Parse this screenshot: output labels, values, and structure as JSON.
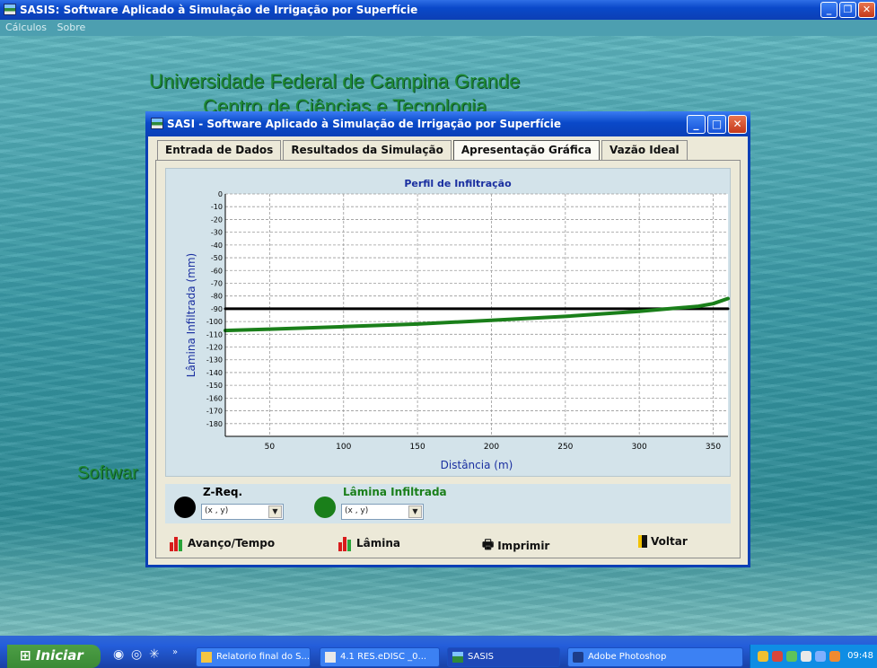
{
  "app": {
    "title": "SASIS: Software Aplicado à Simulação de Irrigação por Superfície",
    "menu": [
      "Cálculos",
      "Sobre"
    ]
  },
  "background": {
    "heading1": "Universidade Federal de Campina Grande",
    "heading2": "Centro de Ciências e Tecnologia",
    "partial_text": "Softwar"
  },
  "dialog": {
    "title": "SASI - Software Aplicado à Simulação de Irrigação por Superfície",
    "tabs": [
      "Entrada de Dados",
      "Resultados da Simulação",
      "Apresentação Gráfica",
      "Vazão Ideal"
    ],
    "active_tab": "Apresentação Gráfica",
    "legend": {
      "zreq_label": "Z-Req.",
      "lamina_label": "Lâmina Infiltrada",
      "combo_value": "(x , y)"
    },
    "buttons": {
      "avanco": "Avanço/Tempo",
      "lamina": "Lâmina",
      "imprimir": "Imprimir",
      "voltar": "Voltar"
    }
  },
  "chart_data": {
    "type": "line",
    "title": "Perfil de Infiltração",
    "xlabel": "Distância (m)",
    "ylabel": "Lâmina Infiltrada (mm)",
    "xlim": [
      20,
      360
    ],
    "ylim": [
      -190,
      0
    ],
    "x_ticks": [
      50,
      100,
      150,
      200,
      250,
      300,
      350
    ],
    "y_ticks": [
      0,
      -10,
      -20,
      -30,
      -40,
      -50,
      -60,
      -70,
      -80,
      -90,
      -100,
      -110,
      -120,
      -130,
      -140,
      -150,
      -160,
      -170,
      -180
    ],
    "grid": true,
    "series": [
      {
        "name": "Z-Req.",
        "color": "#000000",
        "x": [
          20,
          360
        ],
        "y": [
          -90,
          -90
        ]
      },
      {
        "name": "Lâmina Infiltrada",
        "color": "#1a7f1a",
        "x": [
          20,
          50,
          100,
          150,
          200,
          250,
          300,
          320,
          340,
          350,
          360
        ],
        "y": [
          -107,
          -106,
          -104,
          -102,
          -99,
          -96,
          -92,
          -90,
          -88,
          -86,
          -82
        ]
      }
    ]
  },
  "taskbar": {
    "start": "Iniciar",
    "tasks": [
      "Relatorio final do S...",
      "4.1 RES.eDISC _0...",
      "SASIS",
      "Adobe Photoshop"
    ],
    "clock": "09:48"
  },
  "colors": {
    "titlebar": "#0a49c9",
    "chart_bg": "#d3e3ea",
    "zreq": "#000000",
    "lamina": "#1a7f1a"
  }
}
